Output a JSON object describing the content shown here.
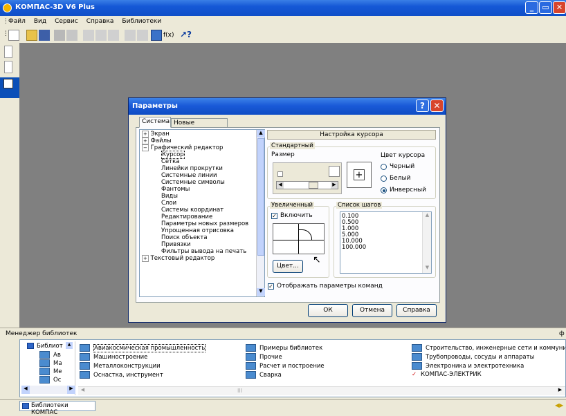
{
  "app": {
    "title": "КОМПАС-3D V6 Plus",
    "menu": [
      "Файл",
      "Вид",
      "Сервис",
      "Справка",
      "Библиотеки"
    ],
    "window_buttons": [
      "minimize",
      "restore",
      "close"
    ]
  },
  "toolbar": {
    "icons": [
      "new-file-icon",
      "open-file-icon",
      "save-icon",
      "print-icon",
      "preview-icon",
      "cut-icon",
      "copy-icon",
      "paste-icon",
      "undo-icon",
      "redo-icon",
      "variables-icon",
      "formula-icon",
      "help-pointer-icon"
    ],
    "formula_label": "f(x)"
  },
  "dialog": {
    "title": "Параметры",
    "tabs": [
      "Система",
      "Новые документы"
    ],
    "active_tab": "Система",
    "tree": [
      {
        "label": "Экран",
        "level": 0,
        "expander": "+"
      },
      {
        "label": "Файлы",
        "level": 0,
        "expander": "+"
      },
      {
        "label": "Графический редактор",
        "level": 0,
        "expander": "−"
      },
      {
        "label": "Курсор",
        "level": 1,
        "selected": true
      },
      {
        "label": "Сетка",
        "level": 1
      },
      {
        "label": "Линейки прокрутки",
        "level": 1
      },
      {
        "label": "Системные линии",
        "level": 1
      },
      {
        "label": "Системные символы",
        "level": 1
      },
      {
        "label": "Фантомы",
        "level": 1
      },
      {
        "label": "Виды",
        "level": 1
      },
      {
        "label": "Слои",
        "level": 1
      },
      {
        "label": "Системы координат",
        "level": 1
      },
      {
        "label": "Редактирование",
        "level": 1
      },
      {
        "label": "Параметры новых размеров",
        "level": 1
      },
      {
        "label": "Упрощенная отрисовка",
        "level": 1
      },
      {
        "label": "Поиск объекта",
        "level": 1
      },
      {
        "label": "Привязки",
        "level": 1
      },
      {
        "label": "Фильтры вывода на печать",
        "level": 1
      },
      {
        "label": "Текстовый редактор",
        "level": 0,
        "expander": "+"
      }
    ],
    "section_header": "Настройка курсора",
    "standard_group": "Стандартный",
    "size_label": "Размер",
    "cursor_color_label": "Цвет курсора",
    "color_options": [
      "Черный",
      "Белый",
      "Инверсный"
    ],
    "selected_color": "Инверсный",
    "enlarged_group": "Увеличенный",
    "enable_label": "Включить",
    "enable_checked": true,
    "color_button": "Цвет...",
    "steps_group": "Список шагов",
    "steps": [
      "0.100",
      "0.500",
      "1.000",
      "5.000",
      "10.000",
      "100.000"
    ],
    "show_params_label": "Отображать параметры команд",
    "show_params_checked": true,
    "buttons": {
      "ok": "ОК",
      "cancel": "Отмена",
      "help": "Справка"
    }
  },
  "library_manager": {
    "title": "Менеджер библиотек",
    "pin": "ф",
    "tree_items": [
      "Библиот",
      "Ав",
      "Ма",
      "Ме",
      "Ос"
    ],
    "columns": [
      [
        "Авиакосмическая промышленность",
        "Машиностроение",
        "Металлоконструкции",
        "Оснастка, инструмент"
      ],
      [
        "Примеры библиотек",
        "Прочие",
        "Расчет и построение",
        "Сварка"
      ],
      [
        "Строительство, инженерные сети и коммуникац",
        "Трубопроводы, сосуды и аппараты",
        "Электроника и электротехника",
        "КОМПАС-ЭЛЕКТРИК"
      ]
    ],
    "selected_item": "Авиакосмическая промышленность",
    "scroll_label": "III"
  },
  "statusbar": {
    "tab_label": "Библиотеки КОМПАС"
  },
  "colors": {
    "titlebar": "#1558d6",
    "workspace": "#808080",
    "dialog_bg": "#ece9d8"
  }
}
